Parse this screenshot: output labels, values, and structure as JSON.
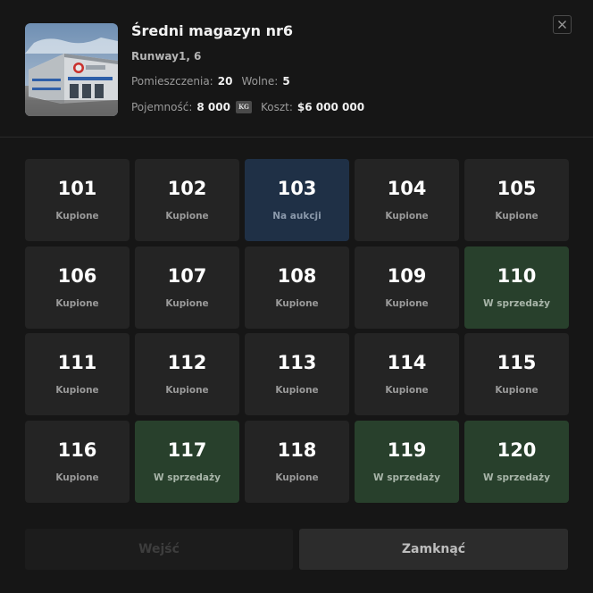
{
  "header": {
    "title": "Średni magazyn nr6",
    "address": "Runway1, 6",
    "rooms_label": "Pomieszczenia:",
    "rooms_value": "20",
    "free_label": "Wolne:",
    "free_value": "5",
    "capacity_label": "Pojemność:",
    "capacity_value": "8 000",
    "unit_icon_text": "KG",
    "cost_label": "Koszt:",
    "cost_value": "$6 000 000"
  },
  "icons": {
    "close": "close-icon",
    "weight": "kg-icon"
  },
  "colors": {
    "background": "#161616",
    "tile_owned": "#242424",
    "tile_auction": "#1f3046",
    "tile_sale": "#28402c"
  },
  "rooms": [
    {
      "number": "101",
      "status": "Kupione",
      "state": "owned"
    },
    {
      "number": "102",
      "status": "Kupione",
      "state": "owned"
    },
    {
      "number": "103",
      "status": "Na aukcji",
      "state": "auction"
    },
    {
      "number": "104",
      "status": "Kupione",
      "state": "owned"
    },
    {
      "number": "105",
      "status": "Kupione",
      "state": "owned"
    },
    {
      "number": "106",
      "status": "Kupione",
      "state": "owned"
    },
    {
      "number": "107",
      "status": "Kupione",
      "state": "owned"
    },
    {
      "number": "108",
      "status": "Kupione",
      "state": "owned"
    },
    {
      "number": "109",
      "status": "Kupione",
      "state": "owned"
    },
    {
      "number": "110",
      "status": "W sprzedaży",
      "state": "sale"
    },
    {
      "number": "111",
      "status": "Kupione",
      "state": "owned"
    },
    {
      "number": "112",
      "status": "Kupione",
      "state": "owned"
    },
    {
      "number": "113",
      "status": "Kupione",
      "state": "owned"
    },
    {
      "number": "114",
      "status": "Kupione",
      "state": "owned"
    },
    {
      "number": "115",
      "status": "Kupione",
      "state": "owned"
    },
    {
      "number": "116",
      "status": "Kupione",
      "state": "owned"
    },
    {
      "number": "117",
      "status": "W sprzedaży",
      "state": "sale"
    },
    {
      "number": "118",
      "status": "Kupione",
      "state": "owned"
    },
    {
      "number": "119",
      "status": "W sprzedaży",
      "state": "sale"
    },
    {
      "number": "120",
      "status": "W sprzedaży",
      "state": "sale"
    }
  ],
  "footer": {
    "enter_label": "Wejść",
    "close_label": "Zamknąć"
  }
}
